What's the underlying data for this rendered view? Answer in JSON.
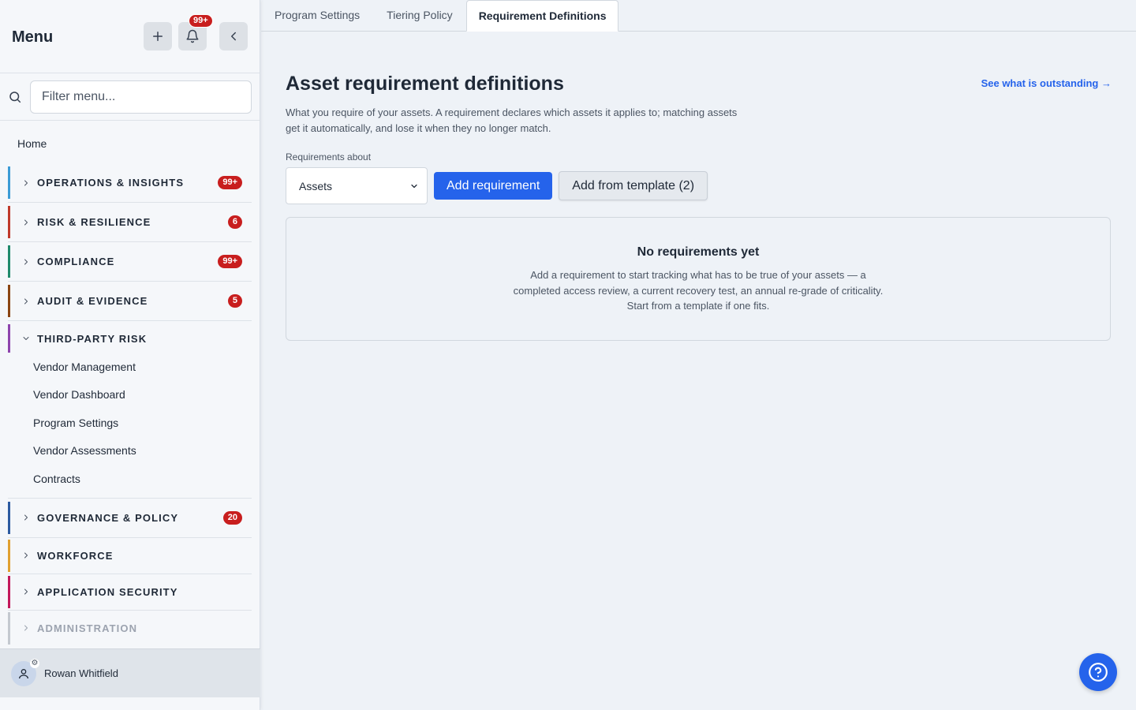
{
  "sidebar": {
    "title": "Menu",
    "notif_badge": "99+",
    "search": {
      "placeholder": "Filter menu..."
    },
    "home": "Home",
    "groups": [
      {
        "label": "OPERATIONS & INSIGHTS",
        "badge": "99+",
        "color": "#3b9bd6"
      },
      {
        "label": "RISK & RESILIENCE",
        "badge": "6",
        "color": "#c0392b"
      },
      {
        "label": "COMPLIANCE",
        "badge": "99+",
        "color": "#1f8a6b"
      },
      {
        "label": "AUDIT & EVIDENCE",
        "badge": "5",
        "color": "#8b4513"
      },
      {
        "label": "THIRD-PARTY RISK",
        "badge": "",
        "color": "#8e44ad",
        "items": [
          "Vendor Management",
          "Vendor Dashboard",
          "Program Settings",
          "Vendor Assessments",
          "Contracts"
        ]
      },
      {
        "label": "GOVERNANCE & POLICY",
        "badge": "20",
        "color": "#2c5aa0"
      },
      {
        "label": "WORKFORCE",
        "badge": "",
        "color": "#e0a030"
      },
      {
        "label": "APPLICATION SECURITY",
        "badge": "",
        "color": "#c2185b"
      },
      {
        "label": "ADMINISTRATION",
        "badge": "",
        "color": "#9ca3af"
      }
    ],
    "user": {
      "name": "Rowan Whitfield"
    }
  },
  "tabs": [
    {
      "label": "Program Settings",
      "active": false
    },
    {
      "label": "Tiering Policy",
      "active": false
    },
    {
      "label": "Requirement Definitions",
      "active": true
    }
  ],
  "main": {
    "title": "Asset requirement definitions",
    "outstanding_link": "See what is outstanding →",
    "description": "What you require of your assets. A requirement declares which assets it applies to; matching assets get it automatically, and lose it when they no longer match.",
    "requirements_label": "Requirements about",
    "select_value": "Assets",
    "add_button": "Add requirement",
    "template_button": "Add from template (2)",
    "empty": {
      "title": "No requirements yet",
      "text": "Add a requirement to start tracking what has to be true of your assets — a completed access review, a current recovery test, an annual re-grade of criticality. Start from a template if one fits."
    }
  },
  "colors": {
    "accent": "#2563eb",
    "badge": "#c81e1e"
  }
}
